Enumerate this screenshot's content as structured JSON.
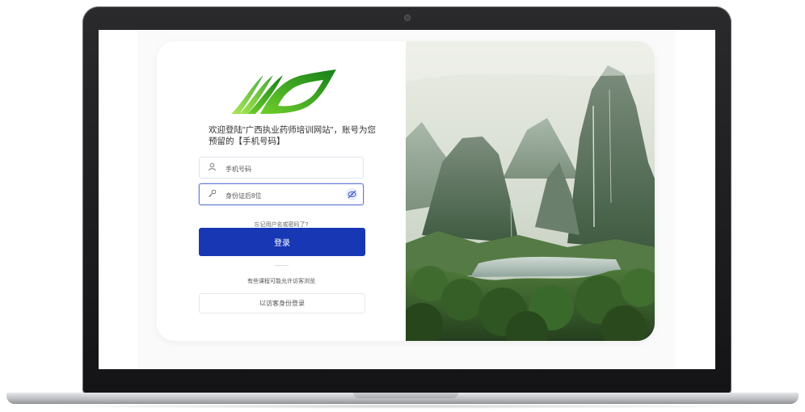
{
  "login": {
    "welcome_text": "欢迎登陆\"广西执业药师培训网站\"，账号为您预留的【手机号码】",
    "phone_placeholder": "手机号码",
    "password_placeholder": "身份证后8位",
    "forgot_link": "忘记用户名或密码了?",
    "login_button": "登录",
    "guest_note": "有些课程可能允许访客浏览",
    "guest_button": "以访客身份登录"
  },
  "icons": {
    "user": "user-icon",
    "key": "key-icon",
    "eye": "eye-off-icon",
    "logo": "leaf-logo"
  },
  "colors": {
    "primary_button": "#1737b5",
    "logo_green_dark": "#1e8a18",
    "logo_green_light": "#7ed321",
    "focus_border": "#6b7fd7"
  }
}
